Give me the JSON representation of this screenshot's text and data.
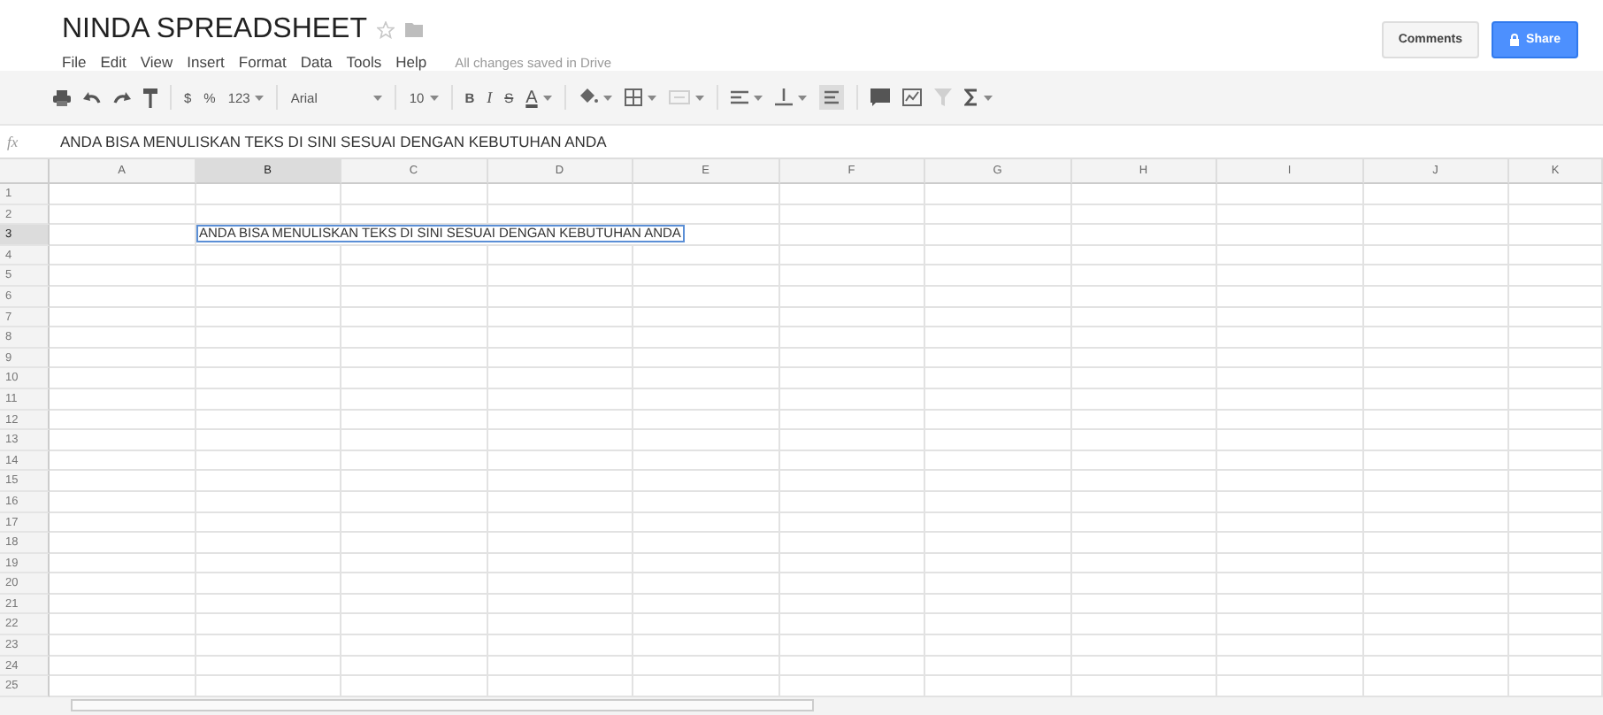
{
  "title": "NINDA SPREADSHEET",
  "starred": false,
  "menu": [
    "File",
    "Edit",
    "View",
    "Insert",
    "Format",
    "Data",
    "Tools",
    "Help"
  ],
  "save_status": "All changes saved in Drive",
  "buttons": [
    {
      "label": "Comments",
      "kind": "plain"
    },
    {
      "label": "Share",
      "kind": "primary"
    }
  ],
  "toolbar": [
    {
      "kind": "print"
    },
    {
      "kind": "undo"
    },
    {
      "kind": "redo"
    },
    {
      "kind": "paint"
    },
    {
      "kind": "sep"
    },
    {
      "kind": "text",
      "label": "$"
    },
    {
      "kind": "text",
      "label": "%"
    },
    {
      "kind": "dropdown",
      "label": "123"
    },
    {
      "kind": "sep"
    },
    {
      "kind": "font",
      "label": "Arial"
    },
    {
      "kind": "sep"
    },
    {
      "kind": "dropdown",
      "label": "10"
    },
    {
      "kind": "sep"
    },
    {
      "kind": "bold",
      "label": "B"
    },
    {
      "kind": "italic",
      "label": "I"
    },
    {
      "kind": "strike",
      "label": "S"
    },
    {
      "kind": "textcolor",
      "label": "A"
    },
    {
      "kind": "sep"
    },
    {
      "kind": "fill"
    },
    {
      "kind": "borders"
    },
    {
      "kind": "merge",
      "disabled": true
    },
    {
      "kind": "sep"
    },
    {
      "kind": "halign"
    },
    {
      "kind": "valign"
    },
    {
      "kind": "wrap",
      "on": true
    },
    {
      "kind": "sep"
    },
    {
      "kind": "comment"
    },
    {
      "kind": "chart"
    },
    {
      "kind": "filter",
      "disabled": true
    },
    {
      "kind": "sum"
    }
  ],
  "formula_bar": {
    "label": "fx",
    "value": "ANDA BISA MENULISKAN TEKS DI SINI SESUAI DENGAN KEBUTUHAN ANDA"
  },
  "columns": [
    {
      "label": "A",
      "selected": false
    },
    {
      "label": "B",
      "selected": true
    },
    {
      "label": "C",
      "selected": false
    },
    {
      "label": "D",
      "selected": false
    },
    {
      "label": "E",
      "selected": false
    },
    {
      "label": "F",
      "selected": false
    },
    {
      "label": "G",
      "selected": false
    },
    {
      "label": "H",
      "selected": false
    },
    {
      "label": "I",
      "selected": false
    },
    {
      "label": "J",
      "selected": false
    },
    {
      "label": "K",
      "selected": false
    }
  ],
  "rows": [
    {
      "label": "1",
      "selected": false
    },
    {
      "label": "2",
      "selected": false
    },
    {
      "label": "3",
      "selected": true,
      "cells": [
        {},
        {
          "text": "ANDA BISA MENULISKAN TEKS DI SINI SESUAI DENGAN KEBUTUHAN ANDA",
          "selected": true
        }
      ]
    },
    {
      "label": "4",
      "selected": false
    },
    {
      "label": "5",
      "selected": false
    },
    {
      "label": "6",
      "selected": false
    },
    {
      "label": "7",
      "selected": false
    },
    {
      "label": "8",
      "selected": false
    },
    {
      "label": "9",
      "selected": false
    },
    {
      "label": "10",
      "selected": false
    },
    {
      "label": "11",
      "selected": false
    },
    {
      "label": "12",
      "selected": false
    },
    {
      "label": "13",
      "selected": false
    },
    {
      "label": "14",
      "selected": false
    },
    {
      "label": "15",
      "selected": false
    },
    {
      "label": "16",
      "selected": false
    },
    {
      "label": "17",
      "selected": false
    },
    {
      "label": "18",
      "selected": false
    },
    {
      "label": "19",
      "selected": false
    },
    {
      "label": "20",
      "selected": false
    },
    {
      "label": "21",
      "selected": false
    },
    {
      "label": "22",
      "selected": false
    },
    {
      "label": "23",
      "selected": false
    },
    {
      "label": "24",
      "selected": false
    },
    {
      "label": "25",
      "selected": false
    }
  ]
}
